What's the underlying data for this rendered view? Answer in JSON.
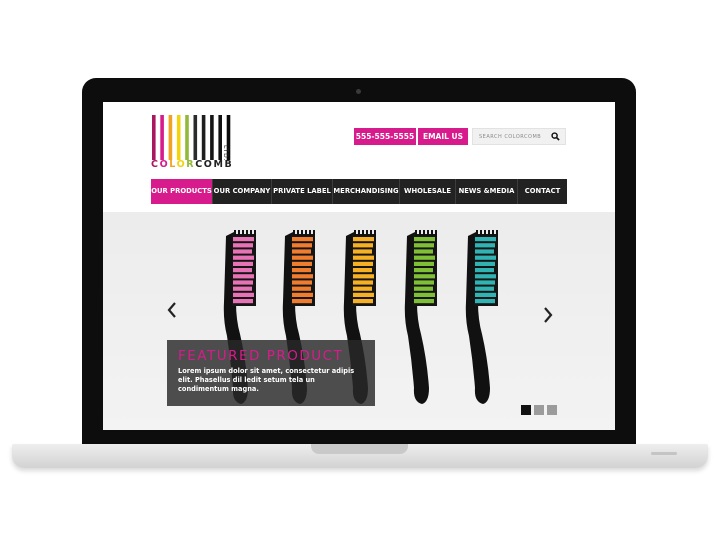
{
  "brand": {
    "word_letters": [
      "C",
      "O",
      "L",
      "O",
      "R",
      "C",
      "O",
      "M",
      "B"
    ],
    "ltd": "LTD.",
    "colors": {
      "magenta": "#d81b8c",
      "dark": "#222222"
    },
    "bar_colors": [
      "#a8175f",
      "#d81b8c",
      "#f0a323",
      "#f2d30e",
      "#92b93a",
      "#2b2b2b",
      "#1e1e1e",
      "#151515",
      "#111111",
      "#0a0a0a"
    ],
    "letter_colors": [
      "#a8175f",
      "#d81b8c",
      "#f0a323",
      "#f2d30e",
      "#92b93a",
      "#222222",
      "#222222",
      "#222222",
      "#222222"
    ]
  },
  "header": {
    "phone": "555-555-5555",
    "email_label": "EMAIL US",
    "search_placeholder": "SEARCH COLORCOMB"
  },
  "nav": {
    "items": [
      {
        "label": "OUR PRODUCTS",
        "active": true
      },
      {
        "label": "OUR COMPANY",
        "active": false
      },
      {
        "label": "PRIVATE LABEL",
        "active": false
      },
      {
        "label": "MERCHANDISING",
        "active": false
      },
      {
        "label": "WHOLESALE",
        "active": false
      },
      {
        "label": "NEWS &MEDIA",
        "active": false
      },
      {
        "label": "CONTACT",
        "active": false
      }
    ]
  },
  "hero": {
    "title": "FEATURED PRODUCT",
    "text": "Lorem ipsum dolor sit amet, consectetur adipis elit. Phasellus dil ledit setum tela un condimentum magna.",
    "comb_colors": [
      "#e872b6",
      "#f07d2e",
      "#f7b023",
      "#7fbf35",
      "#2fb3b3"
    ],
    "slide_count": 3,
    "active_slide": 1
  }
}
